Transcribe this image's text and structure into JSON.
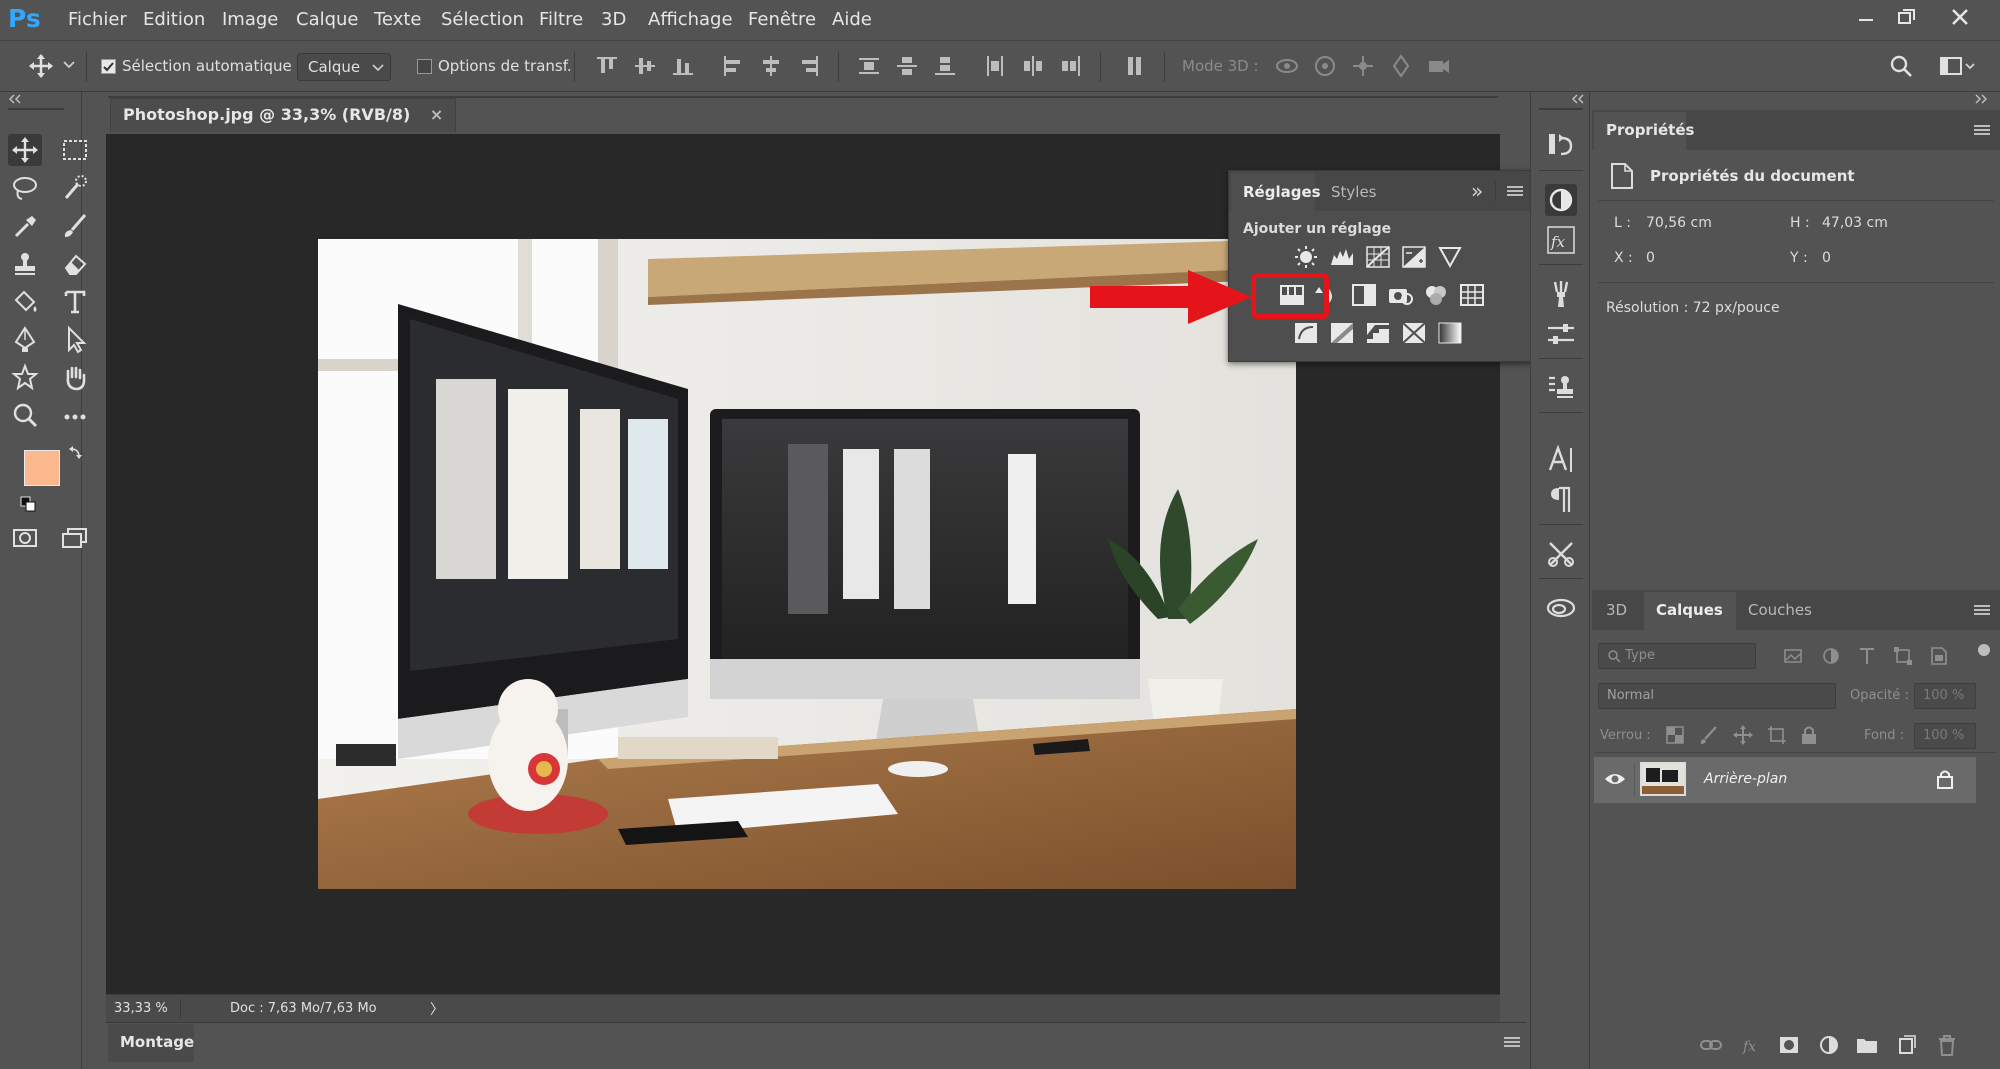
{
  "app": {
    "logo": "Ps",
    "menu": [
      "Fichier",
      "Edition",
      "Image",
      "Calque",
      "Texte",
      "Sélection",
      "Filtre",
      "3D",
      "Affichage",
      "Fenêtre",
      "Aide"
    ],
    "window_controls": [
      "minimize-icon",
      "restore-icon",
      "close-icon"
    ]
  },
  "options": {
    "auto_select_label": "Sélection automatique :",
    "auto_select_checked": true,
    "auto_select_target": "Calque",
    "transform_label": "Options de transf.",
    "transform_checked": false,
    "mode3d_label": "Mode 3D :"
  },
  "document": {
    "tab_title": "Photoshop.jpg @ 33,3% (RVB/8)",
    "tab_close": "×",
    "zoom": "33,33 %",
    "doc_info": "Doc : 7,63 Mo/7,63 Mo",
    "status_arrow": "〉"
  },
  "timeline": {
    "tab_label": "Montage"
  },
  "reglages": {
    "tabs": [
      "Réglages",
      "Styles"
    ],
    "active_tab": "Réglages",
    "heading": "Ajouter un réglage",
    "collapse_glyph": "»"
  },
  "properties": {
    "tab_label": "Propriétés",
    "section_title": "Propriétés du document",
    "width_label": "L :",
    "width_value": "70,56 cm",
    "height_label": "H :",
    "height_value": "47,03 cm",
    "x_label": "X :",
    "x_value": "0",
    "y_label": "Y :",
    "y_value": "0",
    "resolution": "Résolution : 72 px/pouce"
  },
  "layers": {
    "tabs": [
      "3D",
      "Calques",
      "Couches"
    ],
    "active_tab": "Calques",
    "filter_placeholder": "Type",
    "blend_mode": "Normal",
    "opacity_label": "Opacité :",
    "opacity_value": "100 %",
    "lock_label": "Verrou :",
    "fill_label": "Fond :",
    "fill_value": "100 %",
    "items": [
      {
        "name": "Arrière-plan",
        "visible": true,
        "locked": true
      }
    ]
  },
  "colors": {
    "foreground": "#fcb88d",
    "background": "#fcb88d",
    "highlight": "#e5141b",
    "panel": "#535353",
    "canvas": "#282828"
  }
}
